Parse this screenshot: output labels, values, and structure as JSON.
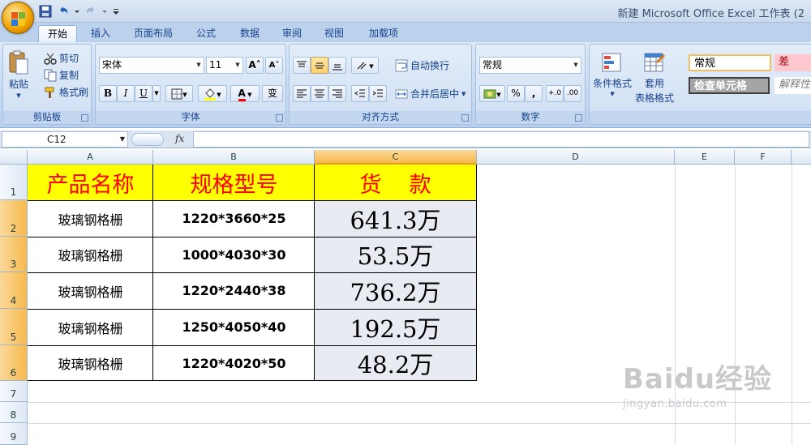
{
  "window": {
    "title": "新建 Microsoft Office Excel 工作表 (2"
  },
  "ribbon_tabs": [
    "开始",
    "插入",
    "页面布局",
    "公式",
    "数据",
    "审阅",
    "视图",
    "加载项"
  ],
  "clipboard": {
    "paste_label": "粘贴",
    "cut_label": "剪切",
    "copy_label": "复制",
    "format_painter_label": "格式刷",
    "group_label": "剪贴板"
  },
  "font": {
    "font_name": "宋体",
    "font_size": "11",
    "bold": "B",
    "italic": "I",
    "underline": "U",
    "phonetic": "变",
    "font_color_glyph": "A",
    "group_label": "字体"
  },
  "alignment": {
    "wrap_text_label": "自动换行",
    "merge_center_label": "合并后居中",
    "group_label": "对齐方式"
  },
  "number": {
    "format_value": "常规",
    "percent": "%",
    "comma": ",",
    "increase_decimal": "+.0",
    "decrease_decimal": ".00",
    "group_label": "数字"
  },
  "styles": {
    "conditional_format_label": "条件格式",
    "table_format_label_1": "套用",
    "table_format_label_2": "表格格式",
    "cell_style_normal": "常规",
    "cell_style_bad": "差",
    "cell_style_check": "检查单元格",
    "cell_style_explanatory": "解释性"
  },
  "formula_bar": {
    "name_box": "C12",
    "fx": "fx",
    "formula": ""
  },
  "grid": {
    "columns": [
      "A",
      "B",
      "C",
      "D",
      "E",
      "F"
    ],
    "selected_column": "C",
    "row_numbers": [
      "1",
      "2",
      "3",
      "4",
      "5",
      "6",
      "7",
      "8",
      "9"
    ],
    "header_row": [
      "产品名称",
      "规格型号",
      "货    款"
    ],
    "rows": [
      [
        "玻璃钢格栅",
        "1220*3660*25",
        "641.3万"
      ],
      [
        "玻璃钢格栅",
        "1000*4030*30",
        "53.5万"
      ],
      [
        "玻璃钢格栅",
        "1220*2440*38",
        "736.2万"
      ],
      [
        "玻璃钢格栅",
        "1250*4050*40",
        "192.5万"
      ],
      [
        "玻璃钢格栅",
        "1220*4020*50",
        "48.2万"
      ]
    ]
  },
  "watermark": {
    "main": "Baidu经验",
    "sub": "jingyan.baidu.com"
  },
  "colors": {
    "header_fill": "#ffff00",
    "header_text": "#ff0000",
    "amount_fill": "#e8ebf2",
    "selected_header": "#f7b94c",
    "ribbon_blue": "#15428b"
  }
}
